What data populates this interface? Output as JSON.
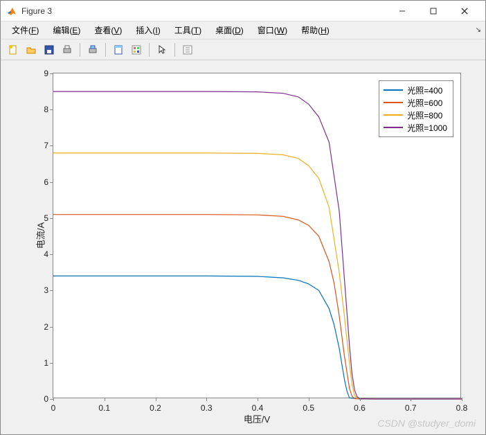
{
  "window": {
    "title": "Figure 3",
    "min_tip": "Minimize",
    "max_tip": "Maximize",
    "close_tip": "Close"
  },
  "menu": {
    "items": [
      {
        "pre": "文件(",
        "key": "F",
        "post": ")"
      },
      {
        "pre": "编辑(",
        "key": "E",
        "post": ")"
      },
      {
        "pre": "查看(",
        "key": "V",
        "post": ")"
      },
      {
        "pre": "插入(",
        "key": "I",
        "post": ")"
      },
      {
        "pre": "工具(",
        "key": "T",
        "post": ")"
      },
      {
        "pre": "桌面(",
        "key": "D",
        "post": ")"
      },
      {
        "pre": "窗口(",
        "key": "W",
        "post": ")"
      },
      {
        "pre": "帮助(",
        "key": "H",
        "post": ")"
      }
    ]
  },
  "toolbar": {
    "items": [
      "new",
      "open",
      "save",
      "print",
      "|",
      "print-preview",
      "|",
      "link",
      "brush",
      "|",
      "pointer",
      "|",
      "insert"
    ]
  },
  "watermark": "CSDN @studyer_domi",
  "chart_data": {
    "type": "line",
    "xlabel": "电压/V",
    "ylabel": "电流/A",
    "xlim": [
      0,
      0.8
    ],
    "ylim": [
      0,
      9
    ],
    "xticks": [
      0,
      0.1,
      0.2,
      0.3,
      0.4,
      0.5,
      0.6,
      0.7,
      0.8
    ],
    "yticks": [
      0,
      1,
      2,
      3,
      4,
      5,
      6,
      7,
      8,
      9
    ],
    "series": [
      {
        "name": "光照=400",
        "color": "#0072bd",
        "x": [
          0,
          0.3,
          0.4,
          0.45,
          0.48,
          0.5,
          0.52,
          0.54,
          0.55,
          0.56,
          0.57,
          0.575,
          0.58,
          0.6,
          0.7,
          0.8
        ],
        "y": [
          3.4,
          3.4,
          3.39,
          3.35,
          3.28,
          3.18,
          3.0,
          2.5,
          2.05,
          1.4,
          0.55,
          0.22,
          0.03,
          0.0,
          0.0,
          0.0
        ]
      },
      {
        "name": "光照=600",
        "color": "#d95319",
        "x": [
          0,
          0.3,
          0.4,
          0.45,
          0.48,
          0.5,
          0.52,
          0.54,
          0.55,
          0.56,
          0.57,
          0.58,
          0.585,
          0.59,
          0.62,
          0.8
        ],
        "y": [
          5.1,
          5.1,
          5.09,
          5.05,
          4.95,
          4.8,
          4.5,
          3.8,
          3.2,
          2.3,
          1.2,
          0.3,
          0.08,
          0.01,
          0.0,
          0.0
        ]
      },
      {
        "name": "光照=800",
        "color": "#edb120",
        "x": [
          0,
          0.3,
          0.4,
          0.45,
          0.48,
          0.5,
          0.52,
          0.54,
          0.56,
          0.57,
          0.58,
          0.585,
          0.59,
          0.595,
          0.62,
          0.8
        ],
        "y": [
          6.8,
          6.8,
          6.79,
          6.75,
          6.65,
          6.45,
          6.1,
          5.3,
          3.5,
          2.3,
          1.0,
          0.4,
          0.1,
          0.02,
          0.0,
          0.0
        ]
      },
      {
        "name": "光照=1000",
        "color": "#7e2f8e",
        "x": [
          0,
          0.3,
          0.4,
          0.45,
          0.48,
          0.5,
          0.52,
          0.54,
          0.56,
          0.58,
          0.585,
          0.59,
          0.595,
          0.6,
          0.63,
          0.8
        ],
        "y": [
          8.5,
          8.5,
          8.49,
          8.45,
          8.35,
          8.15,
          7.8,
          7.1,
          5.2,
          1.5,
          0.7,
          0.25,
          0.06,
          0.01,
          0.0,
          0.0
        ]
      }
    ]
  }
}
